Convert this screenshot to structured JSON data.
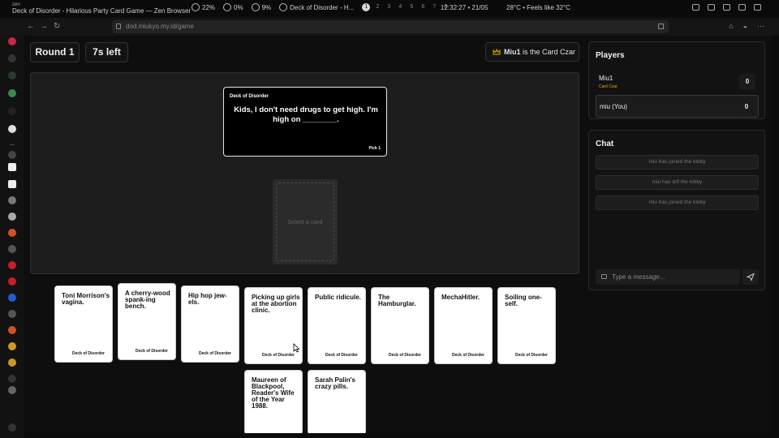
{
  "system_bar": {
    "app_name": "zen",
    "window_title": "Deck of Disorder - Hilarious Party Card Game — Zen Browser",
    "stats": [
      "22%",
      "0%",
      "9%"
    ],
    "active_window": "Deck of Disorder - H...",
    "workspaces": [
      "1",
      "2",
      "3",
      "4",
      "5",
      "6",
      "7",
      "8"
    ],
    "clock": "12:32:27 • 21/05",
    "weather": "28°C • Feels like 32°C"
  },
  "browser": {
    "url": "dod.miukyo.my.id/game"
  },
  "game": {
    "round": "Round 1",
    "timer": "7s left",
    "czar_name": "Miu1",
    "czar_suffix": " is the Card Czar",
    "black_card": {
      "brand": "Deck of Disorder",
      "prompt": "Kids, I don't need drugs to get high. I'm high on ________.",
      "pick": "Pick 1"
    },
    "slot_label": "Select a card",
    "hand": [
      {
        "text": "Toni Morrison's vagina.",
        "brand": "Deck of Disorder"
      },
      {
        "text": "A cherry-wood spank-ing bench.",
        "brand": "Deck of Disorder"
      },
      {
        "text": "Hip hop jew-els.",
        "brand": "Deck of Disorder"
      },
      {
        "text": "Picking up girls at the abortion clinic.",
        "brand": "Deck of Disorder"
      },
      {
        "text": "Public ridicule.",
        "brand": "Deck of Disorder"
      },
      {
        "text": "The Hamburglar.",
        "brand": "Deck of Disorder"
      },
      {
        "text": "MechaHitler.",
        "brand": "Deck of Disorder"
      },
      {
        "text": "Soiling one-self.",
        "brand": "Deck of Disorder"
      },
      {
        "text": "Maureen of Blackpool, Reader's Wife of the Year 1988.",
        "brand": ""
      },
      {
        "text": "Sarah Palin's crazy pills.",
        "brand": ""
      }
    ]
  },
  "players_panel": {
    "title": "Players",
    "players": [
      {
        "name": "Miu1",
        "role": "Card Czar",
        "score": "0"
      },
      {
        "name": "miu (You)",
        "role": "",
        "score": "0"
      }
    ]
  },
  "chat_panel": {
    "title": "Chat",
    "messages": [
      "miu has joined the lobby",
      "miu has left the lobby",
      "miu has joined the lobby"
    ],
    "placeholder": "Type a message..."
  },
  "colors": {
    "accent_gold": "#e0b000",
    "card_white": "#ffffff",
    "card_black": "#000000"
  }
}
